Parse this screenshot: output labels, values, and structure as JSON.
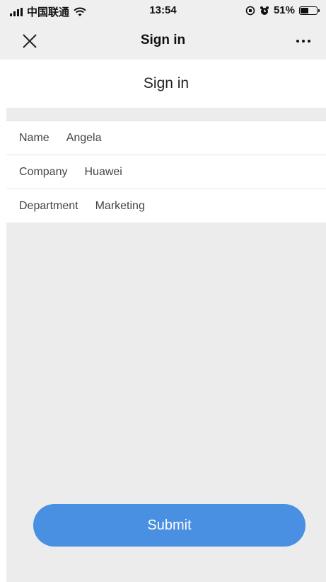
{
  "status_bar": {
    "carrier": "中国联通",
    "time": "13:54",
    "battery_percent": "51%",
    "battery_level": 0.51
  },
  "nav": {
    "title": "Sign in",
    "close_icon": "close-icon",
    "more_icon": "more-icon"
  },
  "page": {
    "header": "Sign in"
  },
  "form": {
    "rows": [
      {
        "label": "Name",
        "value": "Angela"
      },
      {
        "label": "Company",
        "value": "Huawei"
      },
      {
        "label": "Department",
        "value": "Marketing"
      }
    ]
  },
  "actions": {
    "submit_label": "Submit"
  },
  "colors": {
    "accent": "#4a90e2",
    "background": "#ececec"
  }
}
